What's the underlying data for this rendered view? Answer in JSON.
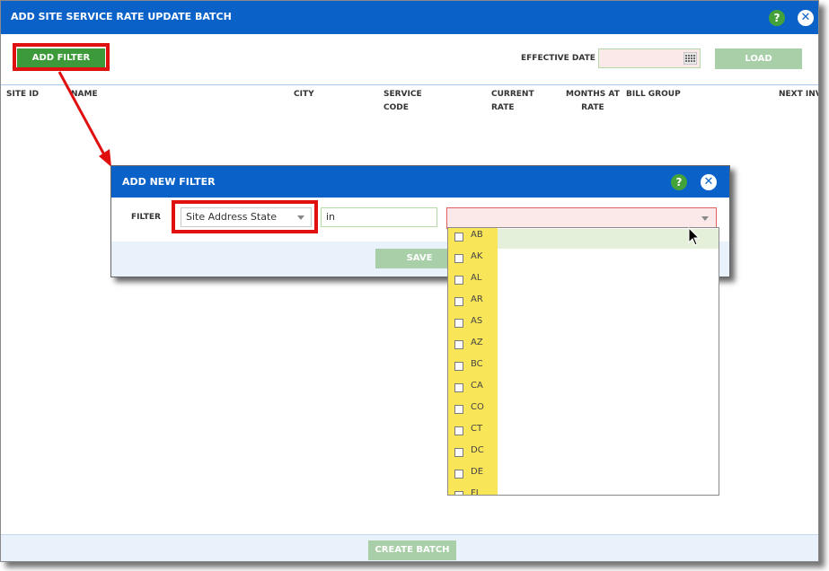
{
  "main": {
    "title": "ADD SITE SERVICE RATE UPDATE BATCH",
    "help_glyph": "?",
    "close_glyph": "✕",
    "add_filter_label": "ADD FILTER",
    "effective_date_label": "EFFECTIVE DATE",
    "effective_date_value": "",
    "load_label": "LOAD",
    "columns": [
      {
        "line1": "SITE ID",
        "line2": ""
      },
      {
        "line1": "NAME",
        "line2": ""
      },
      {
        "line1": "CITY",
        "line2": ""
      },
      {
        "line1": "SERVICE",
        "line2": "CODE"
      },
      {
        "line1": "CURRENT",
        "line2": "RATE"
      },
      {
        "line1": "MONTHS AT",
        "line2": "RATE"
      },
      {
        "line1": "BILL GROUP",
        "line2": ""
      },
      {
        "line1": "NEXT INV",
        "line2": ""
      }
    ],
    "create_batch_label": "CREATE BATCH"
  },
  "filter_dialog": {
    "title": "ADD NEW FILTER",
    "filter_label": "FILTER",
    "field_value": "Site Address State",
    "operator_value": "in",
    "value_selected": "",
    "save_label": "SAVE"
  },
  "state_options": [
    "AB",
    "AK",
    "AL",
    "AR",
    "AS",
    "AZ",
    "BC",
    "CA",
    "CO",
    "CT",
    "DC",
    "DE",
    "FL"
  ],
  "colors": {
    "title_bar": "#0a62c8",
    "green_button": "#3c9a3a",
    "disabled_button": "#a8cfa8",
    "annotation_red": "#e01010",
    "highlight_yellow": "#f8e558"
  }
}
